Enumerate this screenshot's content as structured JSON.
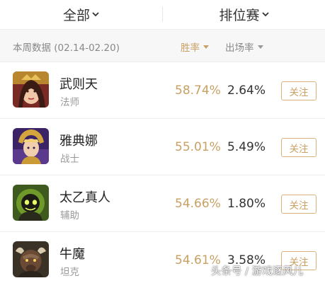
{
  "header": {
    "scope_dropdown": {
      "label": "全部",
      "icon": "chevron-down-icon"
    },
    "mode_dropdown": {
      "label": "排位赛",
      "icon": "chevron-down-icon"
    }
  },
  "filter": {
    "period": "本周数据 (02.14-02.20)",
    "sort_winrate_label": "胜率",
    "sort_pickrate_label": "出场率",
    "active_color": "#c9a063"
  },
  "heroes": [
    {
      "name": "武则天",
      "role": "法师",
      "win_rate": "58.74%",
      "pick_rate": "2.64%",
      "follow_label": "关注",
      "avatar_icon": "hero-wuzetian-avatar"
    },
    {
      "name": "雅典娜",
      "role": "战士",
      "win_rate": "55.01%",
      "pick_rate": "5.49%",
      "follow_label": "关注",
      "avatar_icon": "hero-athena-avatar"
    },
    {
      "name": "太乙真人",
      "role": "辅助",
      "win_rate": "54.66%",
      "pick_rate": "1.80%",
      "follow_label": "关注",
      "avatar_icon": "hero-taiyi-avatar"
    },
    {
      "name": "牛魔",
      "role": "坦克",
      "win_rate": "54.61%",
      "pick_rate": "3.58%",
      "follow_label": "关注",
      "avatar_icon": "hero-niumo-avatar"
    }
  ],
  "watermark": "头条号 / 游戏逐风儿"
}
